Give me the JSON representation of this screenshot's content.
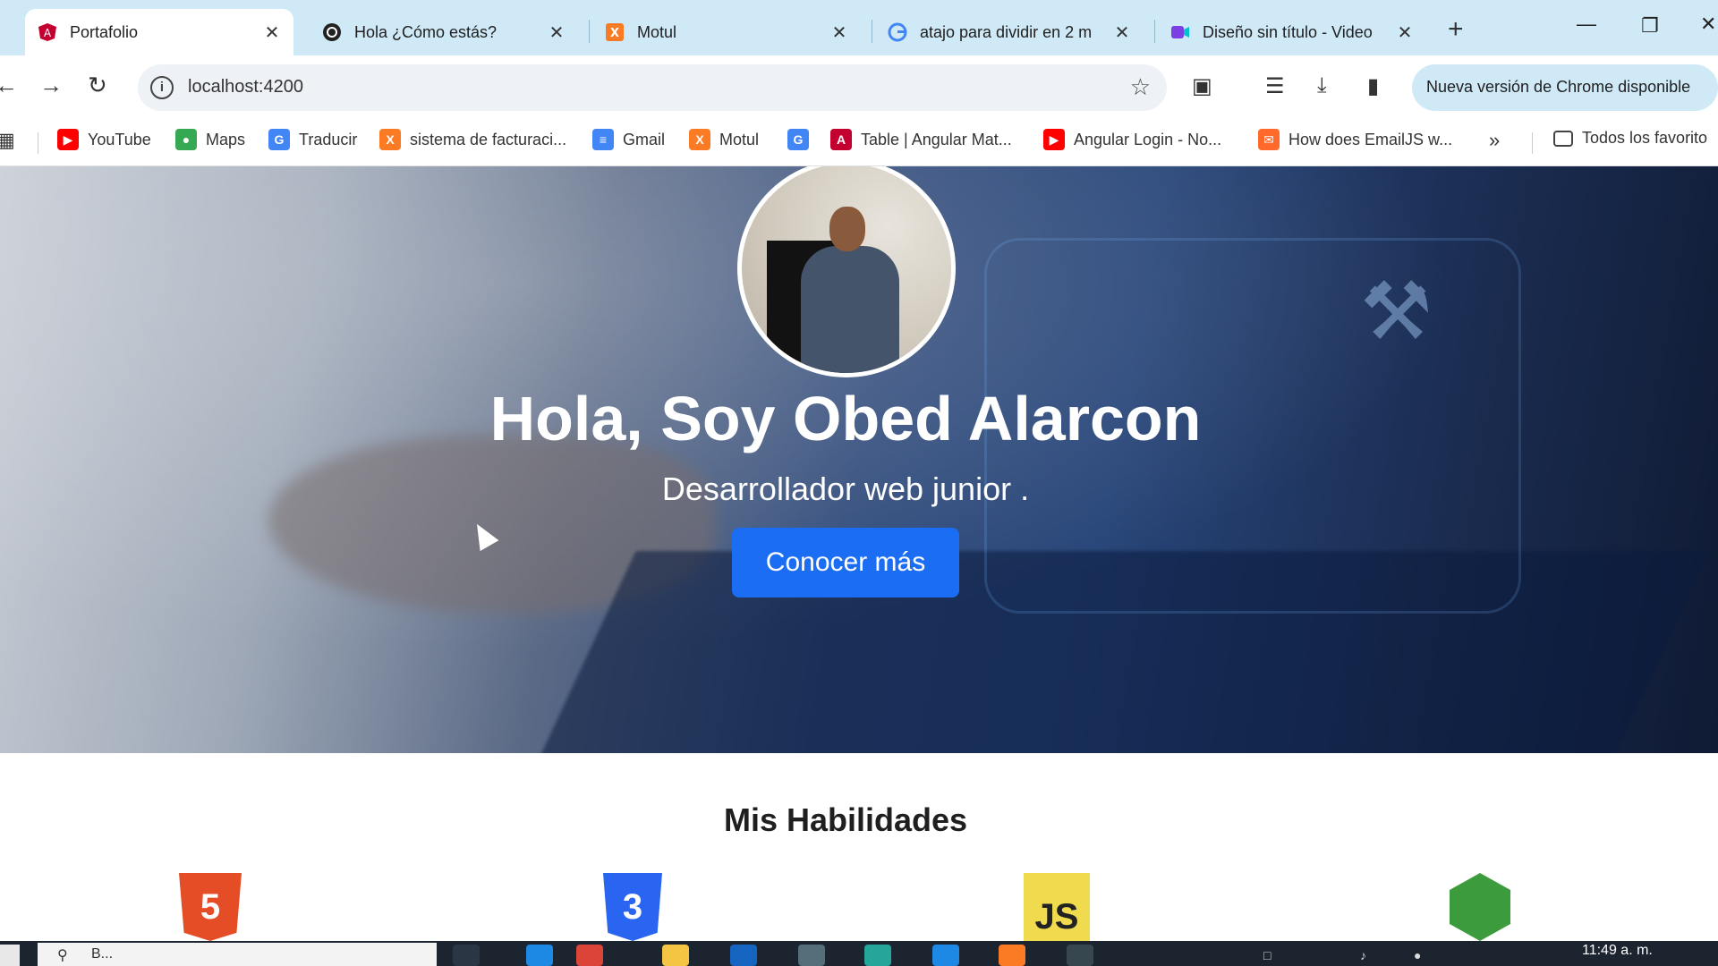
{
  "browser": {
    "tabs": [
      {
        "title": "Portafolio",
        "active": true,
        "icon": "angular-icon"
      },
      {
        "title": "Hola ¿Cómo estás?",
        "active": false,
        "icon": "chatgpt-icon"
      },
      {
        "title": "Motul",
        "active": false,
        "icon": "xampp-icon"
      },
      {
        "title": "atajo para dividir en 2 m",
        "active": false,
        "icon": "google-icon"
      },
      {
        "title": "Diseño sin título - Video",
        "active": false,
        "icon": "canva-video-icon"
      }
    ],
    "close_glyph": "✕",
    "new_tab_glyph": "+",
    "address": "localhost:4200",
    "update_label": "Nueva versión de Chrome disponible",
    "bookmarks": [
      {
        "label": "YouTube",
        "icon": "youtube-icon",
        "color": "#ff0000"
      },
      {
        "label": "Maps",
        "icon": "maps-icon",
        "color": "#34a853"
      },
      {
        "label": "Traducir",
        "icon": "translate-icon",
        "color": "#4285f4"
      },
      {
        "label": "sistema de facturaci...",
        "icon": "xampp-icon",
        "color": "#fb7a24"
      },
      {
        "label": "Gmail",
        "icon": "docs-icon",
        "color": "#4285f4"
      },
      {
        "label": "Motul",
        "icon": "xampp-icon",
        "color": "#fb7a24"
      },
      {
        "label": "",
        "icon": "google-icon",
        "color": "#4285f4"
      },
      {
        "label": "Table | Angular Mat...",
        "icon": "angular-icon",
        "color": "#c3002f"
      },
      {
        "label": "Angular Login - No...",
        "icon": "youtube-icon",
        "color": "#ff0000"
      },
      {
        "label": "How does EmailJS w...",
        "icon": "emailjs-icon",
        "color": "#ff6a2b"
      }
    ],
    "overflow_glyph": "»",
    "all_bookmarks_label": "Todos los favorito"
  },
  "hero": {
    "heading": "Hola, Soy Obed Alarcon",
    "subtitle": "Desarrollador web junior .",
    "cta_label": "Conocer más"
  },
  "skills": {
    "title": "Mis Habilidades",
    "items": [
      {
        "name": "html5-icon",
        "glyph": "5"
      },
      {
        "name": "css3-icon",
        "glyph": "3"
      },
      {
        "name": "javascript-icon",
        "glyph": "JS"
      },
      {
        "name": "nodejs-icon",
        "glyph": ""
      }
    ]
  },
  "taskbar": {
    "search_placeholder": "B...",
    "clock": "11:49 a. m."
  },
  "colors": {
    "accent": "#1b6ef3",
    "tab_strip": "#cfe9f7"
  }
}
